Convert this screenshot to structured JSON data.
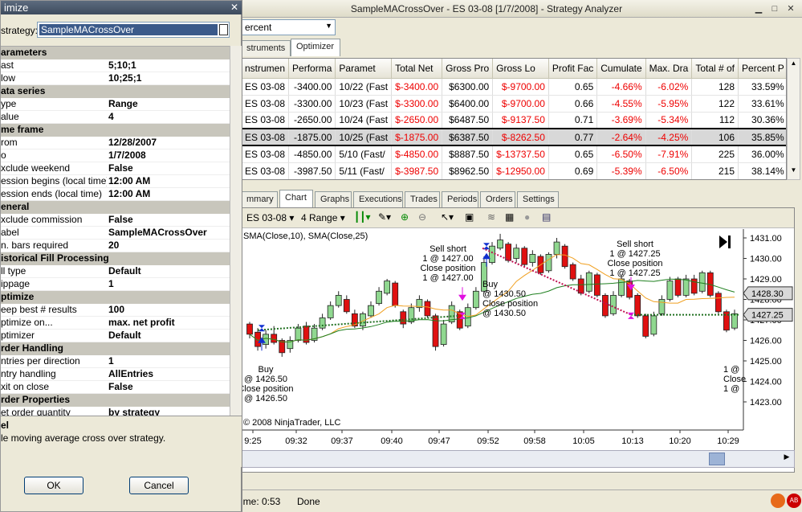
{
  "main_window": {
    "title": "SampleMACrossOver - ES 03-08 [1/7/2008] - Strategy Analyzer",
    "combo_value": "ercent",
    "top_tabs": [
      {
        "label": "struments"
      },
      {
        "label": "Optimizer"
      }
    ],
    "table": {
      "headers": [
        "nstrumen",
        "Performa",
        "Paramet",
        "Total Net",
        "Gross Pro",
        "Gross Lo",
        "Profit Fac",
        "Cumulate",
        "Max. Dra",
        "Total # of",
        "Percent P"
      ],
      "rows": [
        [
          "ES 03-08",
          "-3400.00",
          "10/22 (Fast",
          "$-3400.00",
          "$6300.00",
          "$-9700.00",
          "0.65",
          "-4.66%",
          "-6.02%",
          "128",
          "33.59%"
        ],
        [
          "ES 03-08",
          "-3300.00",
          "10/23 (Fast",
          "$-3300.00",
          "$6400.00",
          "$-9700.00",
          "0.66",
          "-4.55%",
          "-5.95%",
          "122",
          "33.61%"
        ],
        [
          "ES 03-08",
          "-2650.00",
          "10/24 (Fast",
          "$-2650.00",
          "$6487.50",
          "$-9137.50",
          "0.71",
          "-3.69%",
          "-5.34%",
          "112",
          "30.36%"
        ],
        [
          "ES 03-08",
          "-1875.00",
          "10/25 (Fast",
          "$-1875.00",
          "$6387.50",
          "$-8262.50",
          "0.77",
          "-2.64%",
          "-4.25%",
          "106",
          "35.85%"
        ],
        [
          "ES 03-08",
          "-4850.00",
          "5/10 (Fast/",
          "$-4850.00",
          "$8887.50",
          "$-13737.50",
          "0.65",
          "-6.50%",
          "-7.91%",
          "225",
          "36.00%"
        ],
        [
          "ES 03-08",
          "-3987.50",
          "5/11 (Fast/",
          "$-3987.50",
          "$8962.50",
          "$-12950.00",
          "0.69",
          "-5.39%",
          "-6.50%",
          "215",
          "38.14%"
        ]
      ]
    },
    "bottom_tabs": [
      {
        "label": "mmary"
      },
      {
        "label": "Chart"
      },
      {
        "label": "Graphs"
      },
      {
        "label": "Executions"
      },
      {
        "label": "Trades"
      },
      {
        "label": "Periods"
      },
      {
        "label": "Orders"
      },
      {
        "label": "Settings"
      }
    ],
    "chart_toolbar": {
      "instrument": "ES 03-08",
      "period": "4 Range"
    },
    "chart": {
      "indicator_label": "SMA(Close,10), SMA(Close,25)",
      "copyright": "© 2008 NinjaTrader, LLC",
      "price_ticks": [
        "1431.00",
        "1430.00",
        "1429.00",
        "1428.00",
        "1427.00",
        "1426.00",
        "1425.00",
        "1424.00",
        "1423.00"
      ],
      "price_markers": [
        "1428.30",
        "1427.25"
      ],
      "time_ticks": [
        "9:25",
        "09:32",
        "09:37",
        "09:40",
        "09:47",
        "09:52",
        "09:58",
        "10:05",
        "10:13",
        "10:20",
        "10:29"
      ],
      "annotations": [
        {
          "lines": [
            "Sell short",
            "1 @ 1427.25",
            "Close position",
            "1 @ 1427.25"
          ]
        },
        {
          "lines": [
            "Sell short",
            "1 @ 1427.00",
            "Close position",
            "1 @ 1427.00"
          ]
        },
        {
          "lines": [
            "Buy",
            "@ 1430.50",
            "Close position",
            "@ 1430.50"
          ]
        },
        {
          "lines": [
            "Buy",
            "@ 1426.50",
            "Close position",
            "@ 1426.50"
          ]
        },
        {
          "lines": [
            "1 @",
            "Close",
            "1 @"
          ]
        }
      ]
    },
    "status": {
      "time": "ime: 0:53",
      "state": "Done"
    }
  },
  "dialog": {
    "title": "imize",
    "strategy_label": "strategy:",
    "strategy_value": "SampleMACrossOver",
    "properties": [
      {
        "cat": "arameters"
      },
      {
        "k": "ast",
        "v": "5;10;1"
      },
      {
        "k": "low",
        "v": "10;25;1"
      },
      {
        "cat": "ata series"
      },
      {
        "k": "ype",
        "v": "Range"
      },
      {
        "k": "alue",
        "v": "4"
      },
      {
        "cat": "me frame"
      },
      {
        "k": "rom",
        "v": "12/28/2007"
      },
      {
        "k": "o",
        "v": "1/7/2008"
      },
      {
        "k": "xclude weekend",
        "v": "False"
      },
      {
        "k": "ession begins (local time)",
        "v": "12:00 AM"
      },
      {
        "k": "ession ends (local time)",
        "v": "12:00 AM"
      },
      {
        "cat": "eneral"
      },
      {
        "k": "xclude commission",
        "v": "False"
      },
      {
        "k": "abel",
        "v": "SampleMACrossOver"
      },
      {
        "k": "n. bars required",
        "v": "20"
      },
      {
        "cat": "istorical Fill Processing"
      },
      {
        "k": "ll type",
        "v": "Default"
      },
      {
        "k": "ippage",
        "v": "1"
      },
      {
        "cat": "ptimize"
      },
      {
        "k": "eep best # results",
        "v": "100"
      },
      {
        "k": "ptimize on...",
        "v": "max. net profit"
      },
      {
        "k": "ptimizer",
        "v": "Default"
      },
      {
        "cat": "rder Handling"
      },
      {
        "k": "ntries per direction",
        "v": "1"
      },
      {
        "k": "ntry handling",
        "v": "AllEntries"
      },
      {
        "k": "xit on close",
        "v": "False"
      },
      {
        "cat": "rder Properties"
      },
      {
        "k": "et order quantity",
        "v": "by strategy"
      }
    ],
    "desc_title": "el",
    "desc_text": "le moving average cross over strategy.",
    "ok_label": "OK",
    "cancel_label": "Cancel"
  },
  "colors": {
    "negative": "#e00000",
    "bull": "#90d890",
    "bear": "#e01010",
    "sma10": "#f0a020",
    "sma25": "#208020"
  }
}
